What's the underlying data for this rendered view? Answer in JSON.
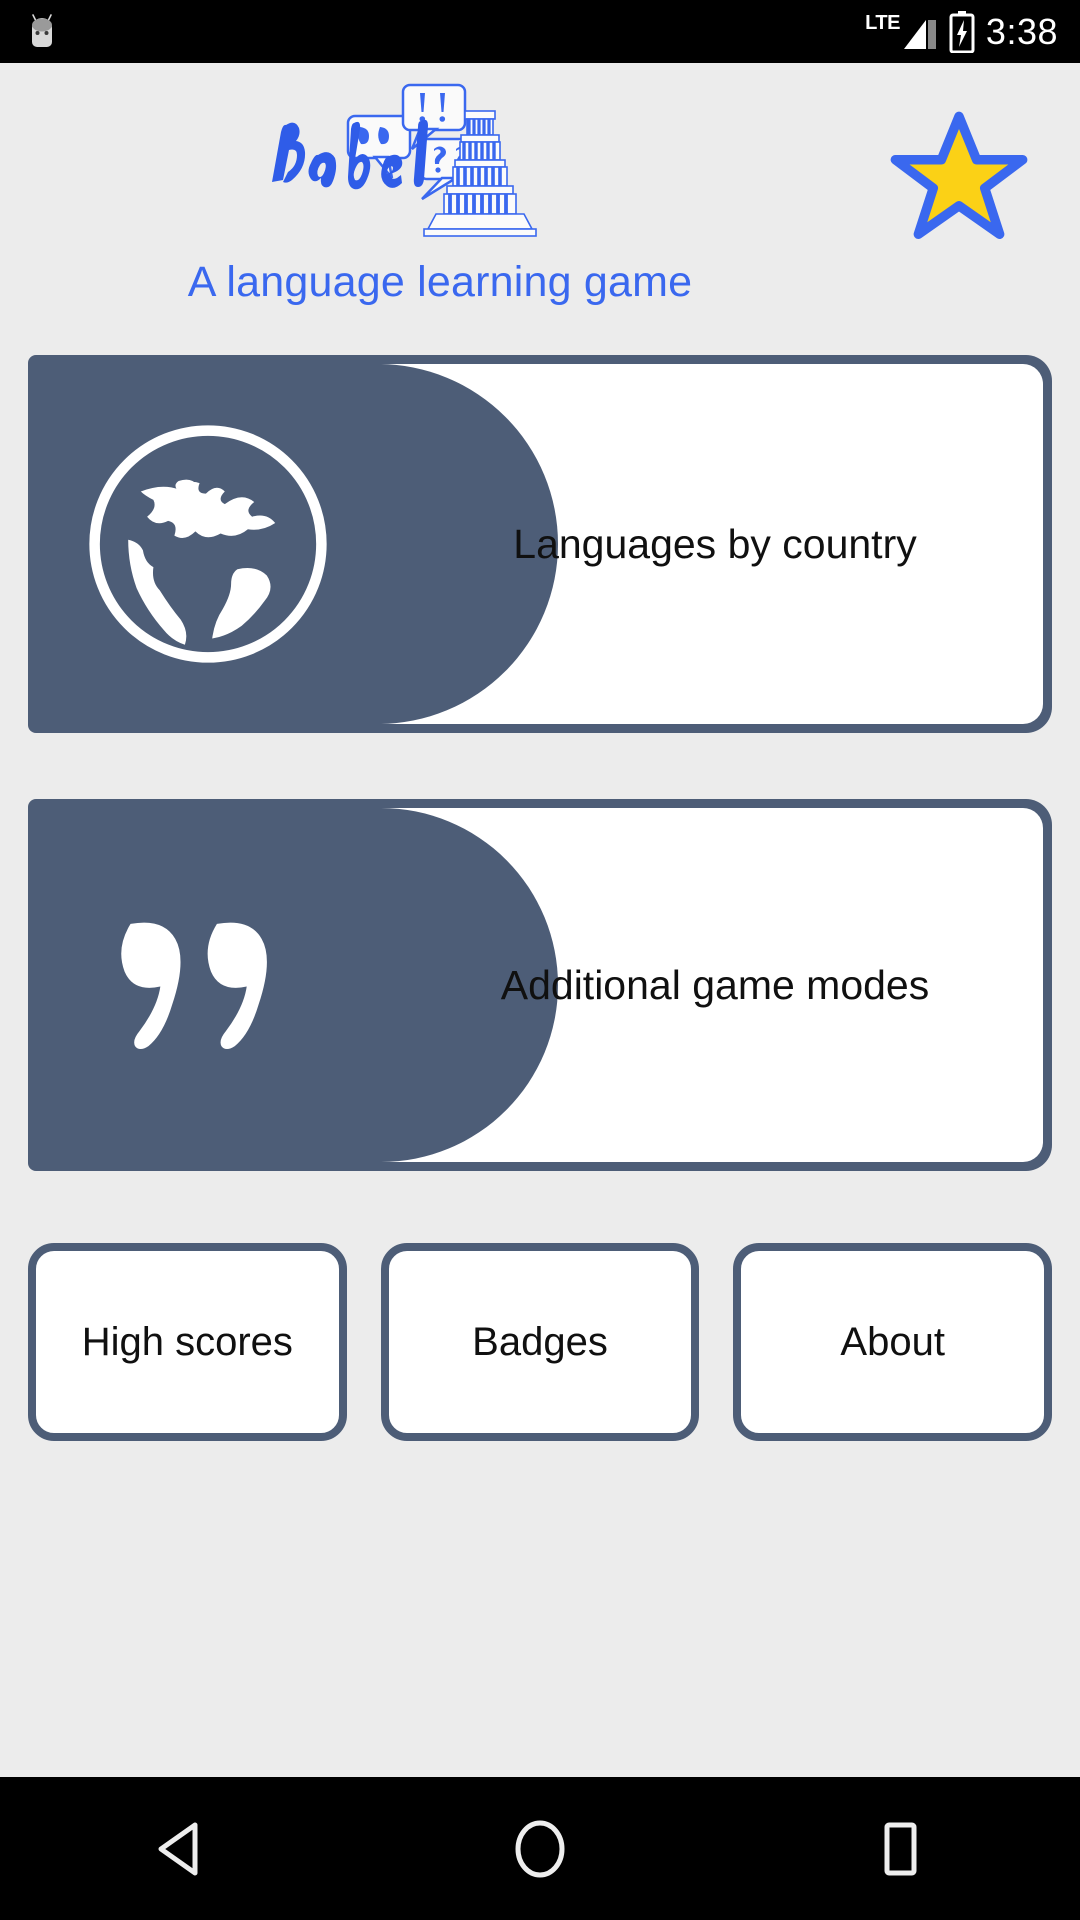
{
  "status_bar": {
    "notification_icon": "android-robot-icon",
    "network_label": "LTE",
    "signal_icon": "signal-bars-icon",
    "battery_icon": "battery-charging-icon",
    "time": "3:38"
  },
  "header": {
    "logo_text": "Babel",
    "logo_icon": "babel-tower-logo",
    "tagline": "A language learning game",
    "star_icon": "star-icon",
    "star_fill_color": "#FBD116",
    "star_stroke_color": "#3a68ef"
  },
  "theme": {
    "background": "#ececec",
    "slate": "#4d5d77",
    "accent_blue": "#3a68ef",
    "card_white": "#ffffff",
    "text_dark": "#101010"
  },
  "main": {
    "cards": [
      {
        "label": "Languages by country",
        "icon": "globe-icon"
      },
      {
        "label": "Additional game modes",
        "icon": "quotation-mark-icon"
      }
    ],
    "buttons": [
      {
        "label": "High scores"
      },
      {
        "label": "Badges"
      },
      {
        "label": "About"
      }
    ]
  },
  "nav_bar": {
    "back": "back-triangle-icon",
    "home": "home-circle-icon",
    "recents": "recents-square-icon"
  }
}
